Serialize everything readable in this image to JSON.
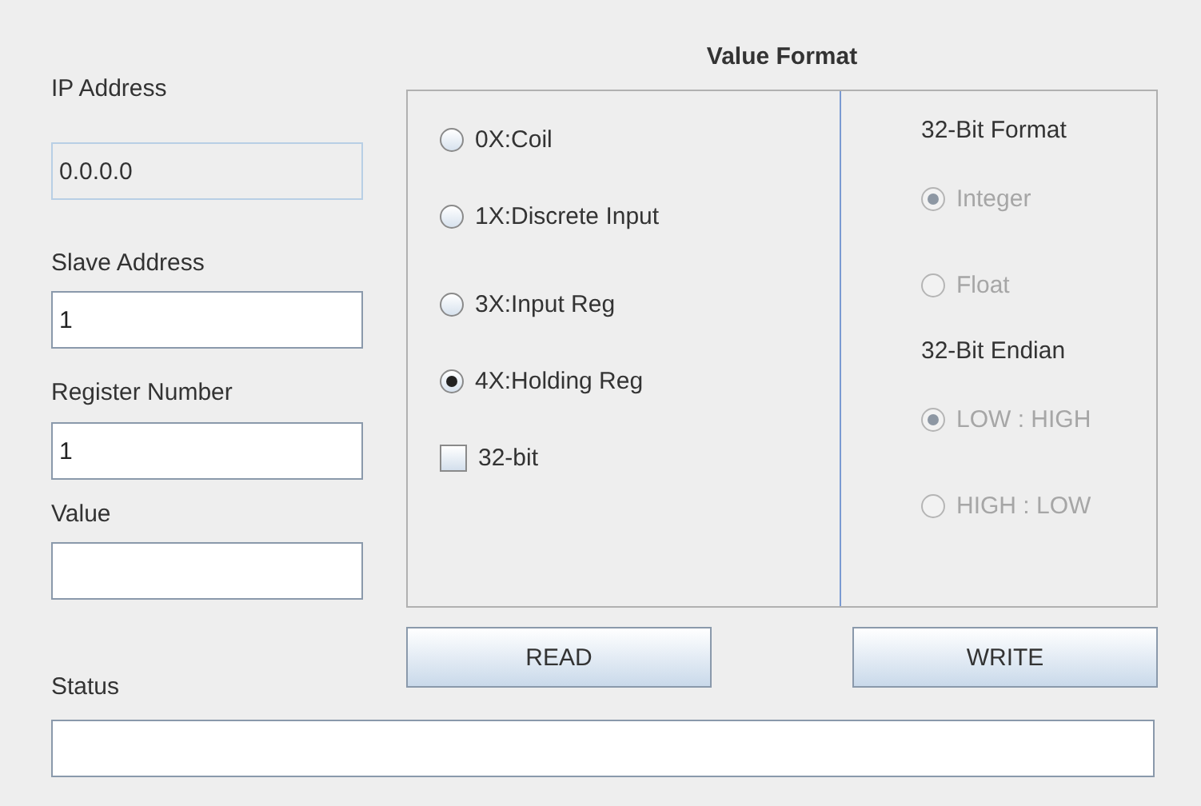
{
  "fields": [
    {
      "label": "IP Address",
      "value": "0.0.0.0",
      "disabled": true
    },
    {
      "label": "Slave Address",
      "value": "1",
      "disabled": false
    },
    {
      "label": "Register Number",
      "value": "1",
      "disabled": false
    },
    {
      "label": "Value",
      "disabled": false
    }
  ],
  "value_format": {
    "title": "Value Format",
    "options": [
      {
        "kind": "radio",
        "label": "0X:Coil",
        "selected": false
      },
      {
        "kind": "radio",
        "label": "1X:Discrete Input",
        "selected": false
      },
      {
        "kind": "radio",
        "label": "3X:Input Reg",
        "selected": false
      },
      {
        "kind": "radio",
        "label": "4X:Holding Reg",
        "selected": true
      },
      {
        "kind": "checkbox",
        "label": "32-bit",
        "checked": false
      }
    ],
    "groups": [
      {
        "heading": "32-Bit Format",
        "options": [
          {
            "label": "Integer",
            "selected": true,
            "disabled": true
          },
          {
            "label": "Float",
            "selected": false,
            "disabled": true
          }
        ]
      },
      {
        "heading": "32-Bit Endian",
        "options": [
          {
            "label": "LOW : HIGH",
            "selected": true,
            "disabled": true
          },
          {
            "label": "HIGH : LOW",
            "selected": false,
            "disabled": true
          }
        ]
      }
    ]
  },
  "buttons": [
    "READ",
    "WRITE"
  ],
  "status": {
    "label": "Status"
  }
}
